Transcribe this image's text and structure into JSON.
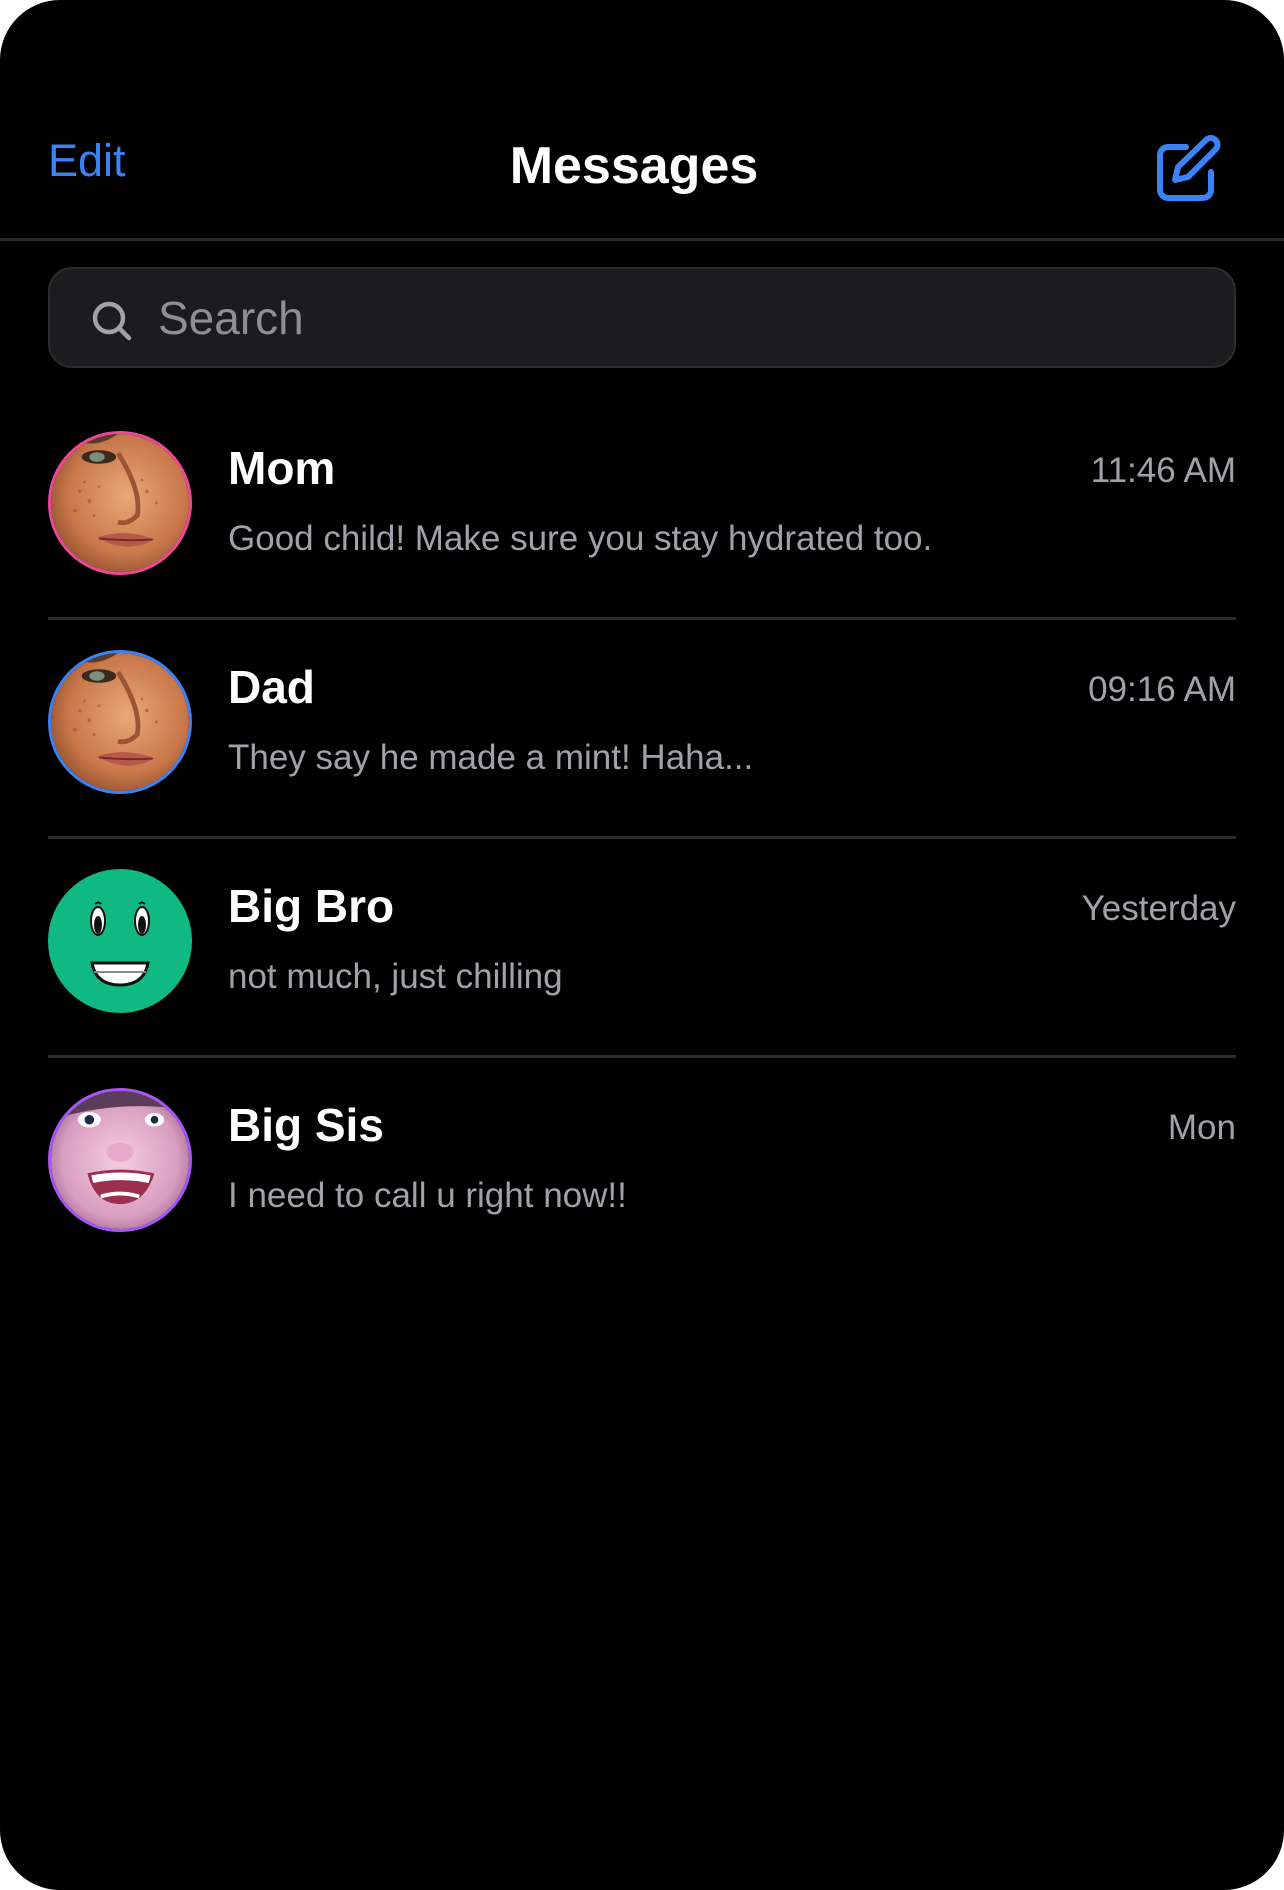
{
  "header": {
    "edit_label": "Edit",
    "title": "Messages",
    "compose_icon": "compose-icon"
  },
  "search": {
    "placeholder": "Search",
    "value": "",
    "icon": "search-icon"
  },
  "conversations": [
    {
      "name": "Mom",
      "time": "11:46 AM",
      "preview": "Good child! Make sure you stay hydrated too.",
      "ring_color": "#ec4899"
    },
    {
      "name": "Dad",
      "time": "09:16 AM",
      "preview": "They say he made a mint! Haha...",
      "ring_color": "#3b82f6"
    },
    {
      "name": "Big Bro",
      "time": "Yesterday",
      "preview": "not much, just chilling",
      "avatar_color": "#10b981"
    },
    {
      "name": "Big Sis",
      "time": "Mon",
      "preview": "I need to call u right now!!",
      "ring_color": "#a855f7"
    }
  ],
  "colors": {
    "background": "#000000",
    "accent": "#3b82f6",
    "secondary_text": "#a1a1aa",
    "divider": "#2c2c2e"
  }
}
